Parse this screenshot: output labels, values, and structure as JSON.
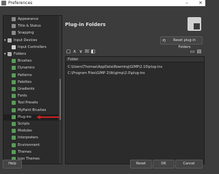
{
  "window": {
    "title": "Preferences"
  },
  "tree": {
    "items": [
      {
        "label": "Appearance",
        "icon": "appearance-icon",
        "level": 2,
        "color": "#8a8a8a"
      },
      {
        "label": "Title & Status",
        "icon": "title-status-icon",
        "level": 2,
        "color": "#8a8a8a"
      },
      {
        "label": "Snapping",
        "icon": "snapping-icon",
        "level": 2,
        "color": "#8a8a8a"
      },
      {
        "label": "Input Devices",
        "icon": "input-devices-icon",
        "level": 1,
        "color": "#b0b0b0"
      },
      {
        "label": "Input Controllers",
        "icon": "input-controllers-icon",
        "level": 2,
        "color": "#cfcfcf"
      },
      {
        "label": "Folders",
        "icon": "folders-icon",
        "level": 1,
        "color": "#b0b0b0"
      },
      {
        "label": "Brushes",
        "icon": "brushes-icon",
        "level": 2,
        "color": "#5a9a5a"
      },
      {
        "label": "Dynamics",
        "icon": "dynamics-icon",
        "level": 2,
        "color": "#5a9a5a"
      },
      {
        "label": "Patterns",
        "icon": "patterns-icon",
        "level": 2,
        "color": "#5a9a5a"
      },
      {
        "label": "Palettes",
        "icon": "palettes-icon",
        "level": 2,
        "color": "#5a9a5a"
      },
      {
        "label": "Gradients",
        "icon": "gradients-icon",
        "level": 2,
        "color": "#5a9a5a"
      },
      {
        "label": "Fonts",
        "icon": "fonts-icon",
        "level": 2,
        "color": "#5a9a5a"
      },
      {
        "label": "Tool Presets",
        "icon": "tool-presets-icon",
        "level": 2,
        "color": "#5a9a5a"
      },
      {
        "label": "MyPaint Brushes",
        "icon": "mypaint-brushes-icon",
        "level": 2,
        "color": "#5a9a5a"
      },
      {
        "label": "Plug-ins",
        "icon": "plug-ins-icon",
        "level": 2,
        "color": "#5a9a5a",
        "selected": true
      },
      {
        "label": "Scripts",
        "icon": "scripts-icon",
        "level": 2,
        "color": "#5a9a5a"
      },
      {
        "label": "Modules",
        "icon": "modules-icon",
        "level": 2,
        "color": "#5a9a5a"
      },
      {
        "label": "Interpreters",
        "icon": "interpreters-icon",
        "level": 2,
        "color": "#5a9a5a"
      },
      {
        "label": "Environment",
        "icon": "environment-icon",
        "level": 2,
        "color": "#5a9a5a"
      },
      {
        "label": "Themes",
        "icon": "themes-icon",
        "level": 2,
        "color": "#5a9a5a"
      },
      {
        "label": "Icon Themes",
        "icon": "icon-themes-icon",
        "level": 2,
        "color": "#5a9a5a"
      }
    ]
  },
  "panel": {
    "title": "Plug-in Folders",
    "icon": "plugin-puzzle-icon",
    "reset_label": "Reset plug-in Folders",
    "list_header": "Folder",
    "folders": [
      "C:\\Users\\Thomas\\AppData\\Roaming\\GIMP\\2.10\\plug-ins",
      "C:\\Program Files\\GIMP 2\\lib\\gimp\\2.0\\plug-ins"
    ]
  },
  "buttons": {
    "help": "Help",
    "reset": "Reset",
    "ok": "OK",
    "cancel": "Cancel"
  },
  "colors": {
    "accent_arrow": "#cc2222",
    "background": "#3c3c3c",
    "list_bg": "#2b2b2b"
  }
}
